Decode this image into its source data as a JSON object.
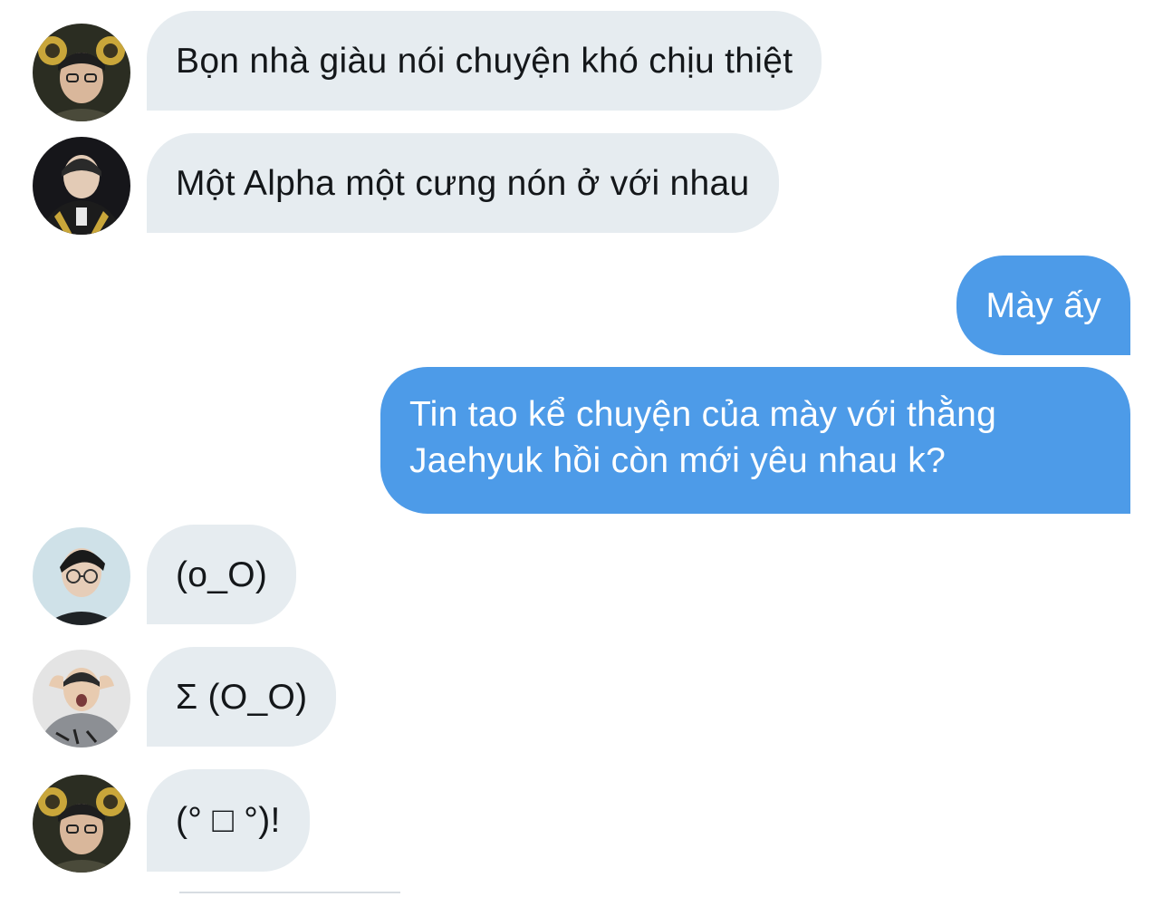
{
  "colors": {
    "incoming_bubble": "#e6ecf0",
    "outgoing_bubble": "#4d9be8",
    "incoming_text": "#14171a",
    "outgoing_text": "#ffffff"
  },
  "messages": [
    {
      "direction": "incoming",
      "avatar": "avatar-gold-headset-icon",
      "text": "Bọn nhà giàu nói chuyện khó chịu thiệt"
    },
    {
      "direction": "incoming",
      "avatar": "avatar-dark-jersey-icon",
      "text": "Một Alpha một cưng nón ở với nhau"
    },
    {
      "direction": "outgoing",
      "text": "Mày ấy"
    },
    {
      "direction": "outgoing",
      "text": "Tin tao kể chuyện của mày với thằng Jaehyuk hồi còn mới yêu nhau k?"
    },
    {
      "direction": "incoming",
      "avatar": "avatar-glasses-portrait-icon",
      "text": "(o_O)"
    },
    {
      "direction": "incoming",
      "avatar": "avatar-grey-hoodie-icon",
      "text": "Σ (O_O)"
    },
    {
      "direction": "incoming",
      "avatar": "avatar-gold-headset-icon",
      "text": "(° □ °)!"
    }
  ]
}
